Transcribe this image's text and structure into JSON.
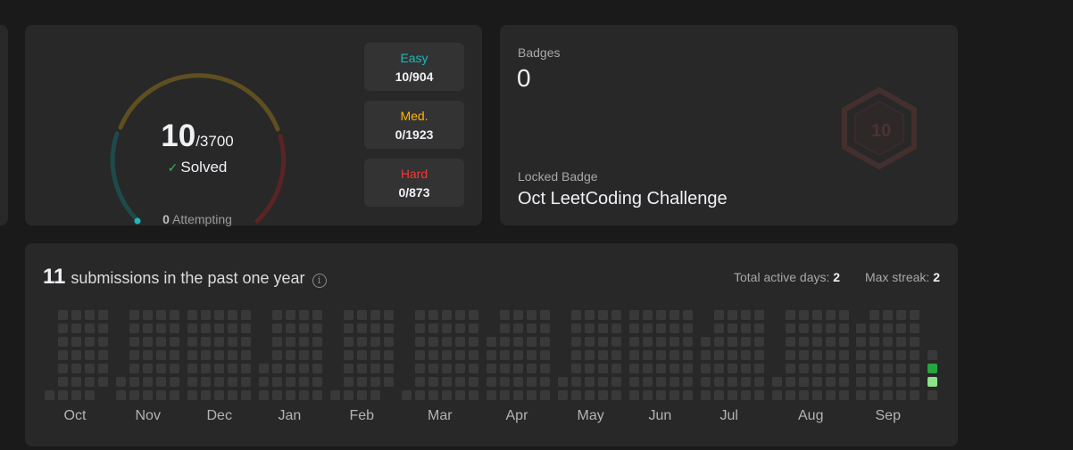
{
  "solved": {
    "count": "10",
    "total": "/3700",
    "solved_label": "Solved",
    "attempting_count": "0",
    "attempting_label": "Attempting",
    "easy": {
      "label": "Easy",
      "value": "10/904",
      "color": "#1cbaba"
    },
    "medium": {
      "label": "Med.",
      "value": "0/1923",
      "color": "#ffb700"
    },
    "hard": {
      "label": "Hard",
      "value": "0/873",
      "color": "#f63737"
    }
  },
  "badges": {
    "title": "Badges",
    "count": "0",
    "locked_label": "Locked Badge",
    "locked_name": "Oct LeetCoding Challenge",
    "badge_icon": "10-day-badge-icon"
  },
  "heatmap": {
    "count": "11",
    "text": "submissions in the past one year",
    "info_icon": "i",
    "total_active_label": "Total active days:",
    "total_active_value": "2",
    "max_streak_label": "Max streak:",
    "max_streak_value": "2",
    "months": [
      "Oct",
      "Nov",
      "Dec",
      "Jan",
      "Feb",
      "Mar",
      "Apr",
      "May",
      "Jun",
      "Jul",
      "Aug",
      "Sep"
    ],
    "colors": {
      "empty": "#393939",
      "level1": "#8ee28a",
      "level2": "#26a641"
    }
  }
}
